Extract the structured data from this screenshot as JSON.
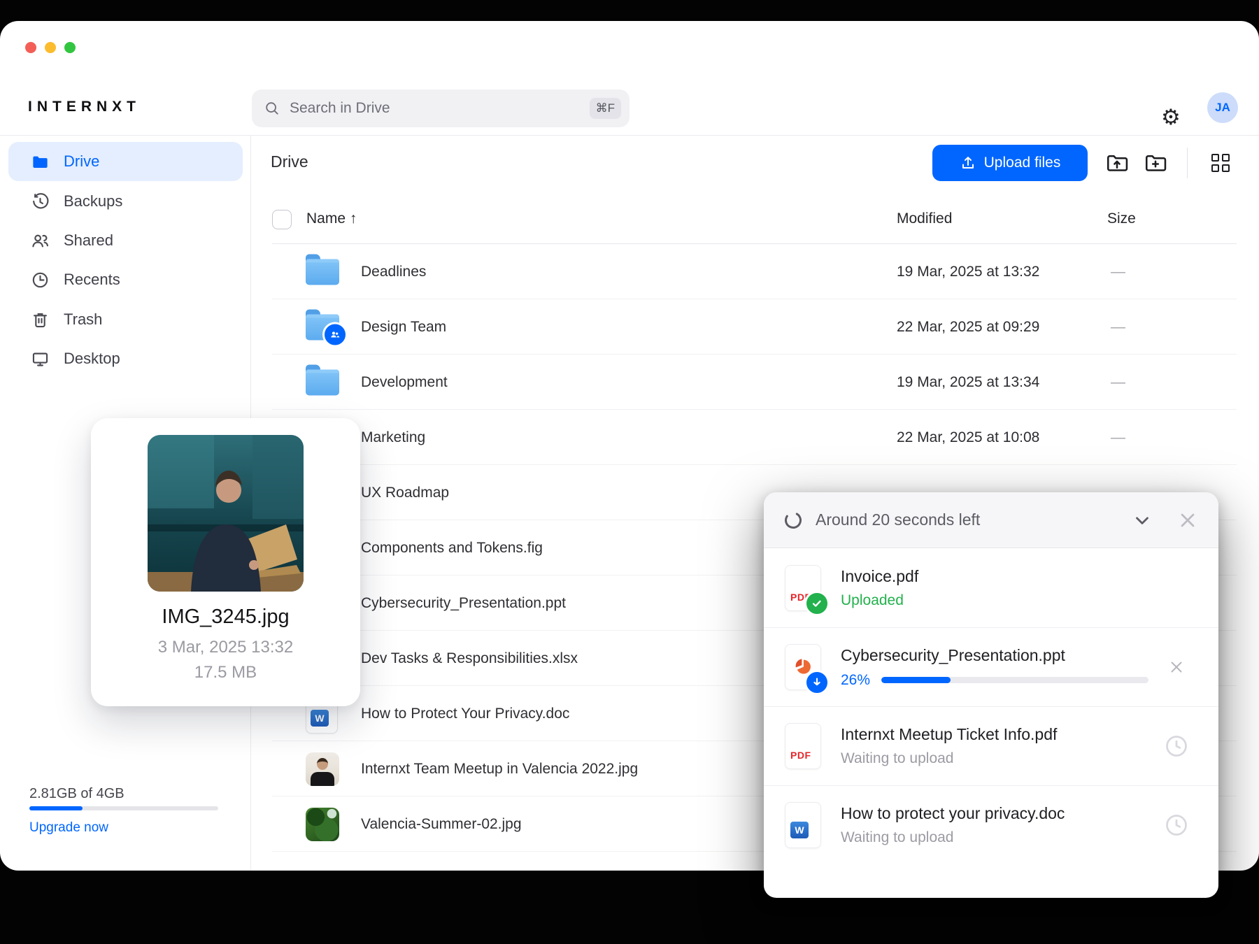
{
  "topbar": {
    "logo": "INTERNXT",
    "search_placeholder": "Search in Drive",
    "search_shortcut": "⌘F",
    "avatar_initials": "JA"
  },
  "sidebar": {
    "items": [
      {
        "label": "Drive"
      },
      {
        "label": "Backups"
      },
      {
        "label": "Shared"
      },
      {
        "label": "Recents"
      },
      {
        "label": "Trash"
      },
      {
        "label": "Desktop"
      }
    ],
    "storage": {
      "usage": "2.81GB of 4GB",
      "percent": 28,
      "upgrade_label": "Upgrade now"
    }
  },
  "content": {
    "title": "Drive",
    "upload_button": "Upload files",
    "columns": {
      "name": "Name",
      "modified": "Modified",
      "size": "Size"
    },
    "sort_arrow": "↑",
    "rows": [
      {
        "name": "Deadlines",
        "modified": "19 Mar, 2025 at 13:32",
        "size": "—"
      },
      {
        "name": "Design Team",
        "modified": "22 Mar, 2025 at 09:29",
        "size": "—"
      },
      {
        "name": "Development",
        "modified": "19 Mar, 2025 at 13:34",
        "size": "—"
      },
      {
        "name": "Marketing",
        "modified": "22 Mar, 2025 at 10:08",
        "size": "—"
      },
      {
        "name": "UX Roadmap",
        "modified": "",
        "size": ""
      },
      {
        "name": "Components and Tokens.fig",
        "modified": "",
        "size": ""
      },
      {
        "name": "Cybersecurity_Presentation.ppt",
        "modified": "",
        "size": ""
      },
      {
        "name": "Dev Tasks & Responsibilities.xlsx",
        "modified": "",
        "size": ""
      },
      {
        "name": "How to Protect Your Privacy.doc",
        "modified": "",
        "size": ""
      },
      {
        "name": "Internxt Team Meetup in Valencia 2022.jpg",
        "modified": "",
        "size": ""
      },
      {
        "name": "Valencia-Summer-02.jpg",
        "modified": "",
        "size": ""
      }
    ]
  },
  "preview_card": {
    "filename": "IMG_3245.jpg",
    "date": "3 Mar, 2025 13:32",
    "size": "17.5 MB"
  },
  "upload_panel": {
    "title": "Around 20 seconds left",
    "items": [
      {
        "name": "Invoice.pdf",
        "type": "pdf",
        "status": "Uploaded"
      },
      {
        "name": "Cybersecurity_Presentation.ppt",
        "type": "ppt",
        "percent": "26%"
      },
      {
        "name": "Internxt Meetup Ticket Info.pdf",
        "type": "pdf",
        "status": "Waiting to upload"
      },
      {
        "name": "How to protect your privacy.doc",
        "type": "doc",
        "status": "Waiting to upload"
      }
    ],
    "pdf_icon_label": "PDF",
    "word_icon_label": "W"
  }
}
